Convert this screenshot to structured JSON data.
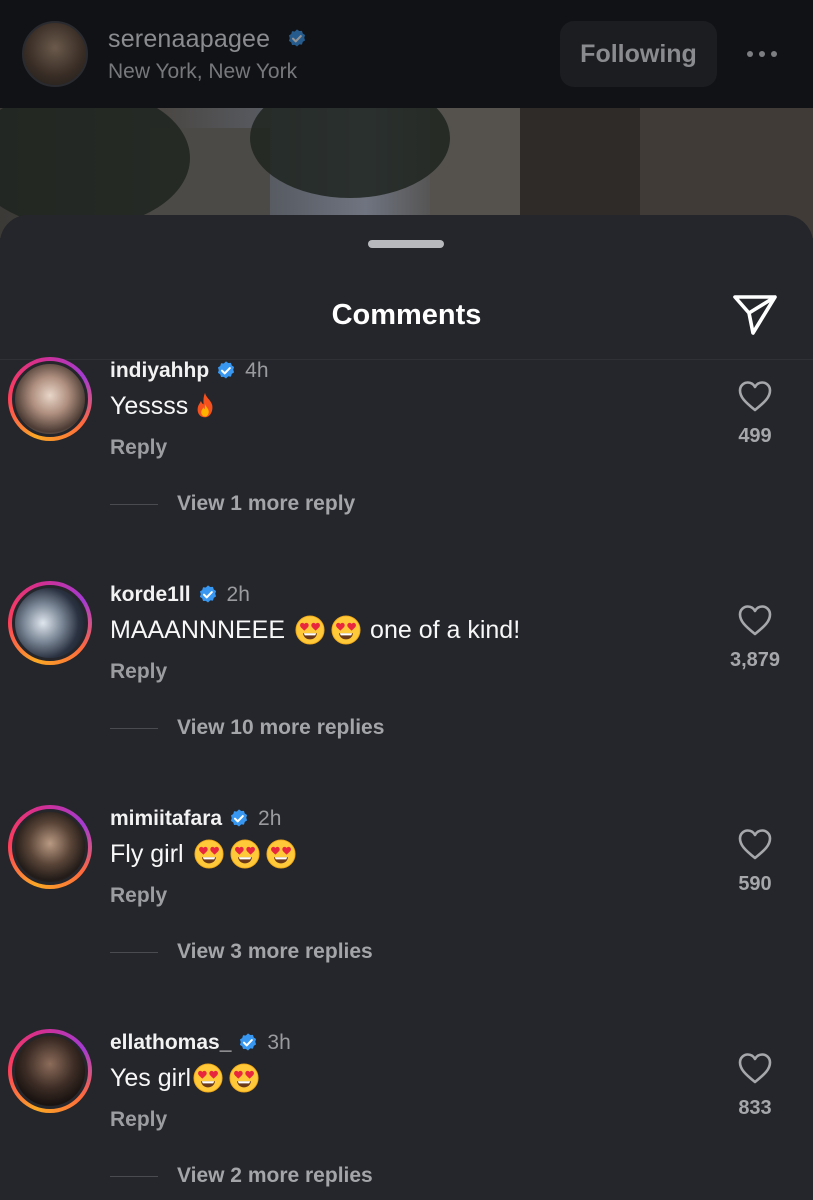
{
  "post_header": {
    "username": "serenaapagee",
    "location": "New York, New York",
    "follow_label": "Following"
  },
  "sheet": {
    "title": "Comments"
  },
  "comments": [
    {
      "username": "indiyahhp",
      "time": "4h",
      "text": "Yessss",
      "emojis": [
        "fire"
      ],
      "reply_label": "Reply",
      "likes": "499",
      "view_more": "View 1 more reply"
    },
    {
      "username": "korde1ll",
      "time": "2h",
      "text_before": "MAAANNNEEE",
      "text_after": "one of a kind!",
      "emojis": [
        "heart-eyes",
        "heart-eyes"
      ],
      "reply_label": "Reply",
      "likes": "3,879",
      "view_more": "View 10 more replies"
    },
    {
      "username": "mimiitafara",
      "time": "2h",
      "text": "Fly girl",
      "emojis": [
        "heart-eyes",
        "heart-eyes",
        "heart-eyes"
      ],
      "reply_label": "Reply",
      "likes": "590",
      "view_more": "View 3 more replies"
    },
    {
      "username": "ellathomas_",
      "time": "3h",
      "text": "Yes girl",
      "emojis": [
        "heart-eyes",
        "heart-eyes"
      ],
      "reply_label": "Reply",
      "likes": "833",
      "view_more": "View 2 more replies"
    }
  ],
  "icons": {
    "verified": "verified-badge-icon",
    "share": "paper-plane-icon",
    "like": "heart-outline-icon",
    "more": "ellipsis-icon"
  },
  "colors": {
    "sheet_bg": "#25262b",
    "verified_blue": "#3897f0",
    "ring_start": "#f9a825",
    "ring_end": "#d32f8f"
  }
}
